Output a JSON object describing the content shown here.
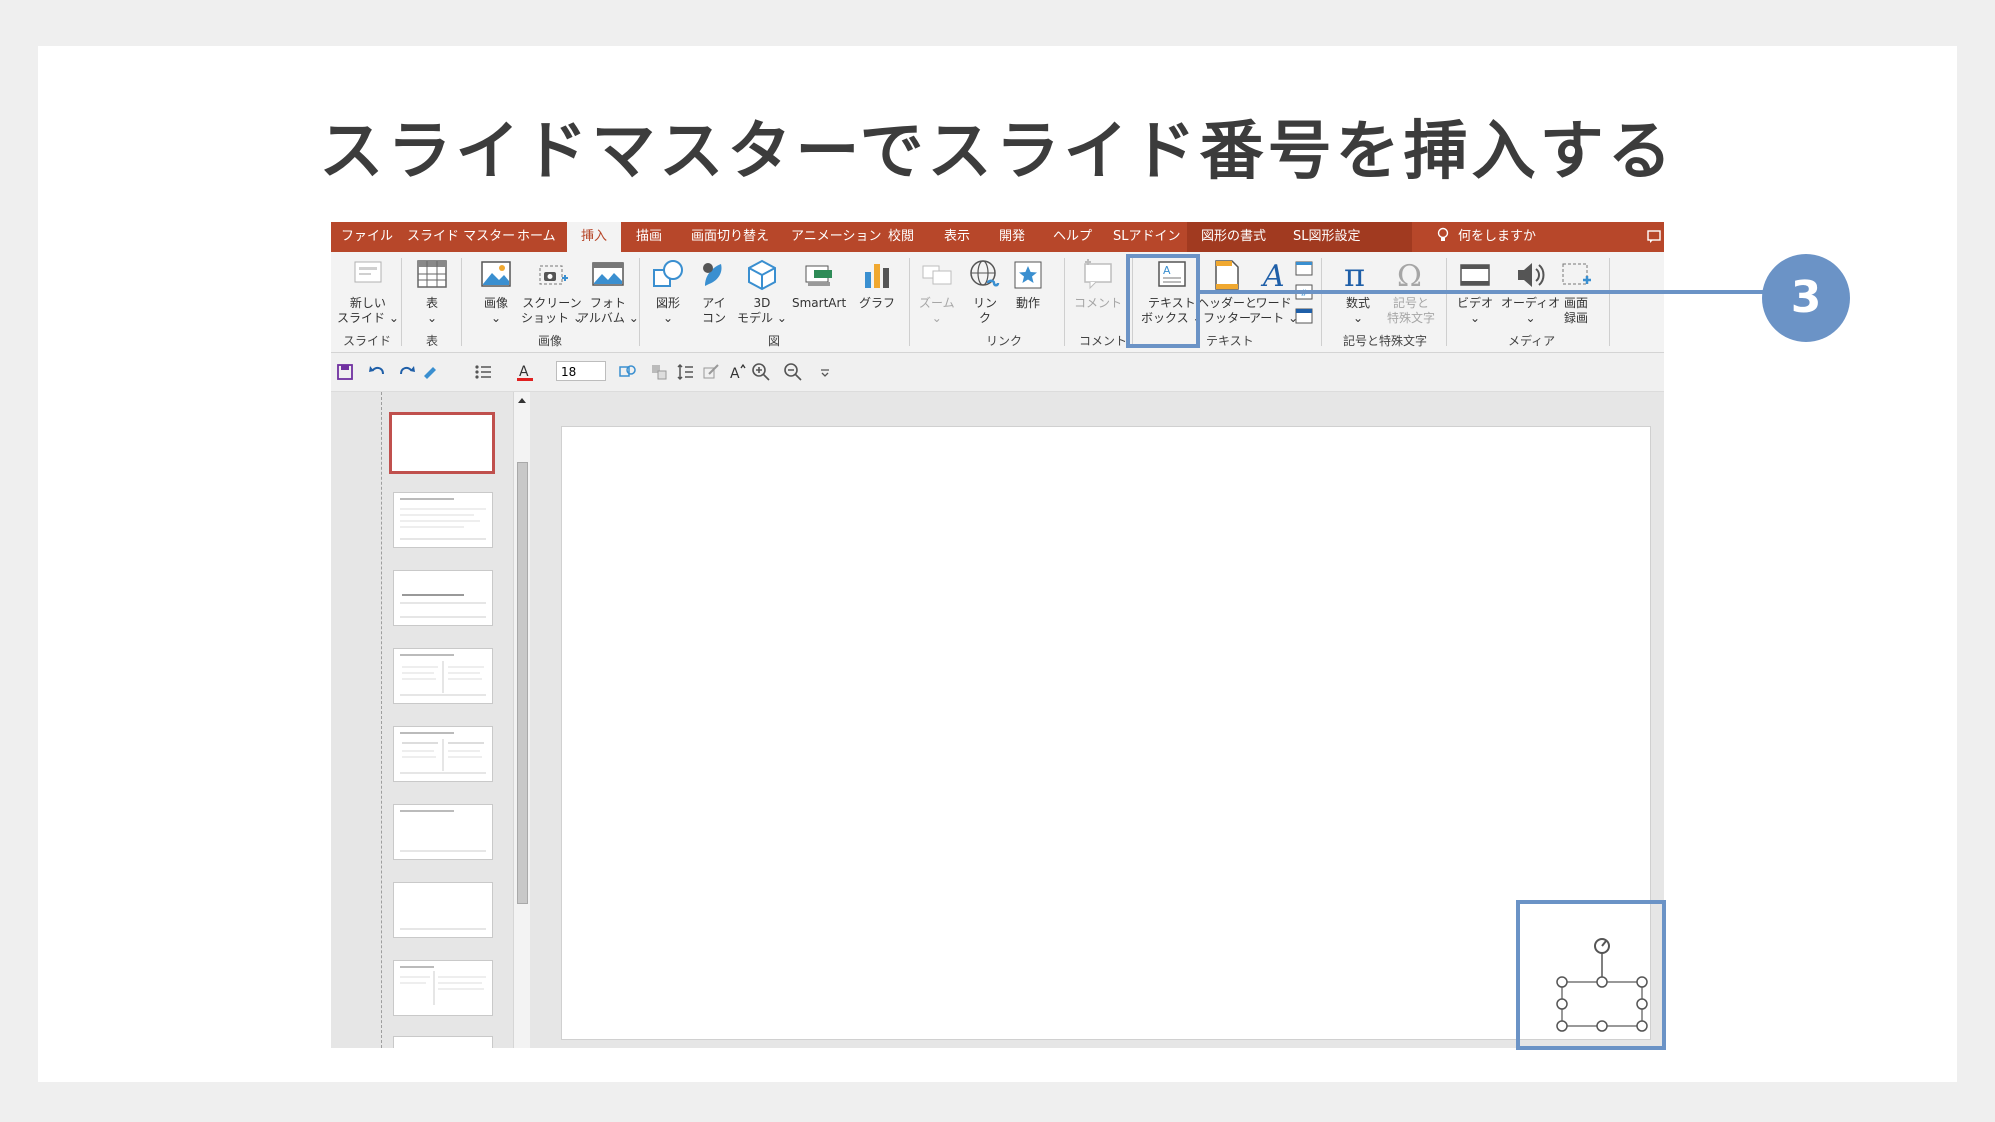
{
  "page": {
    "title": "スライドマスターでスライド番号を挿入する"
  },
  "ribbon_tabs": [
    "ファイル",
    "スライド マスター",
    "ホーム",
    "挿入",
    "描画",
    "画面切り替え",
    "アニメーション",
    "校閲",
    "表示",
    "開発",
    "ヘルプ",
    "SLアドイン",
    "図形の書式",
    "SL図形設定",
    "何をしますか"
  ],
  "active_tab": "挿入",
  "ribbon": {
    "new_slide": "新しい\nスライド ⌄",
    "table": "表\n⌄",
    "image": "画像\n⌄",
    "screenshot": "スクリーン\nショット ⌄",
    "photo_album": "フォト\nアルバム ⌄",
    "shapes": "図形\n⌄",
    "icons": "アイ\nコン",
    "model3d": "3D\nモデル ⌄",
    "smartart": "SmartArt",
    "chart": "グラフ",
    "zoom": "ズーム\n⌄",
    "link": "リン\nク",
    "action": "動作",
    "comment": "コメント",
    "textbox": "テキスト\nボックス ⌄",
    "header_footer": "ヘッダーと\nフッター",
    "wordart": "ワード\nアート ⌄",
    "equation": "数式\n⌄",
    "symbol": "記号と\n特殊文字",
    "video": "ビデオ\n⌄",
    "audio": "オーディオ\n⌄",
    "screen_record": "画面\n録画"
  },
  "groups": {
    "slide": "スライド",
    "table": "表",
    "image": "画像",
    "figure": "図",
    "link": "リンク",
    "comment": "コメント",
    "text": "テキスト",
    "symbols": "記号と特殊文字",
    "media": "メディア"
  },
  "qat": {
    "font_size": "18"
  },
  "callout": {
    "number": "3"
  },
  "colors": {
    "accent": "#b7472a",
    "highlight": "#6b93c6"
  }
}
